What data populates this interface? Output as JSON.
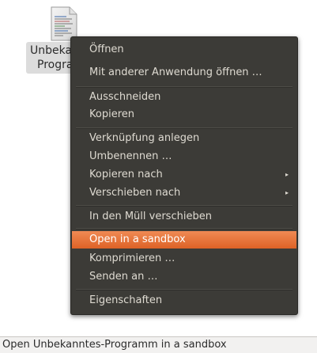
{
  "file": {
    "label_line1": "Unbekan",
    "label_line2": "Progra",
    "icon": "text-file-icon"
  },
  "menu": {
    "items": [
      {
        "label": "Öffnen"
      },
      {
        "label": "Mit anderer Anwendung öffnen …"
      },
      {
        "label": "Ausschneiden"
      },
      {
        "label": "Kopieren"
      },
      {
        "label": "Verknüpfung anlegen"
      },
      {
        "label": "Umbenennen …"
      },
      {
        "label": "Kopieren nach",
        "submenu": true
      },
      {
        "label": "Verschieben nach",
        "submenu": true
      },
      {
        "label": "In den Müll verschieben"
      },
      {
        "label": "Open in a sandbox",
        "highlighted": true
      },
      {
        "label": "Komprimieren …"
      },
      {
        "label": "Senden an …"
      },
      {
        "label": "Eigenschaften"
      }
    ],
    "submenu_arrow": "▸"
  },
  "statusbar": {
    "text": "Open Unbekanntes-Programm in a sandbox"
  },
  "colors": {
    "menu_bg": "#3c3b37",
    "menu_text": "#dfdbd2",
    "highlight": "#e4723c",
    "statusbar_bg": "#f2f1f0"
  }
}
